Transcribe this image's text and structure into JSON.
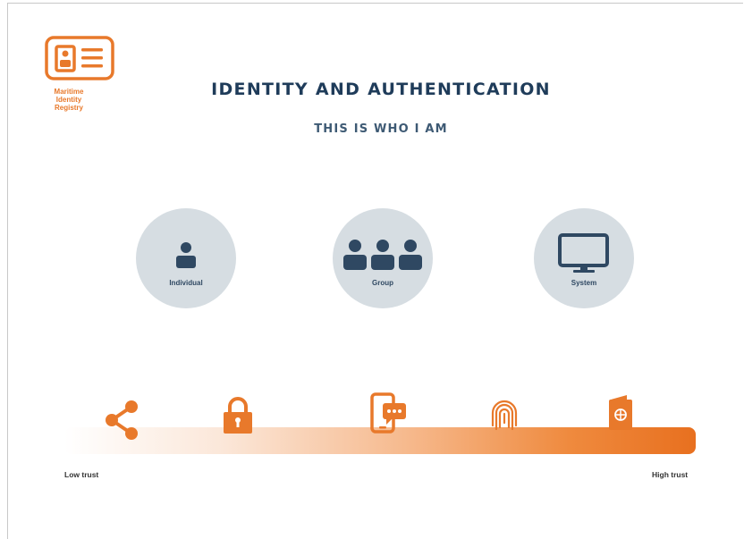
{
  "logo": {
    "text": "Maritime Identity Registry",
    "color": "#e8792b"
  },
  "title": "IDENTITY AND AUTHENTICATION",
  "subtitle": "THIS IS WHO I AM",
  "entities": [
    {
      "label": "Individual",
      "icon": "person-icon"
    },
    {
      "label": "Group",
      "icon": "group-icon"
    },
    {
      "label": "System",
      "icon": "monitor-icon"
    }
  ],
  "auth_methods": [
    {
      "icon": "share-icon"
    },
    {
      "icon": "padlock-icon"
    },
    {
      "icon": "mobile-message-icon"
    },
    {
      "icon": "fingerprint-icon"
    },
    {
      "icon": "passport-icon"
    }
  ],
  "trust_scale": {
    "low_label": "Low trust",
    "high_label": "High trust"
  },
  "colors": {
    "accent": "#e8792b",
    "title": "#1f3c5a",
    "circle": "#d6dde2",
    "icon_dark": "#2f4862"
  }
}
